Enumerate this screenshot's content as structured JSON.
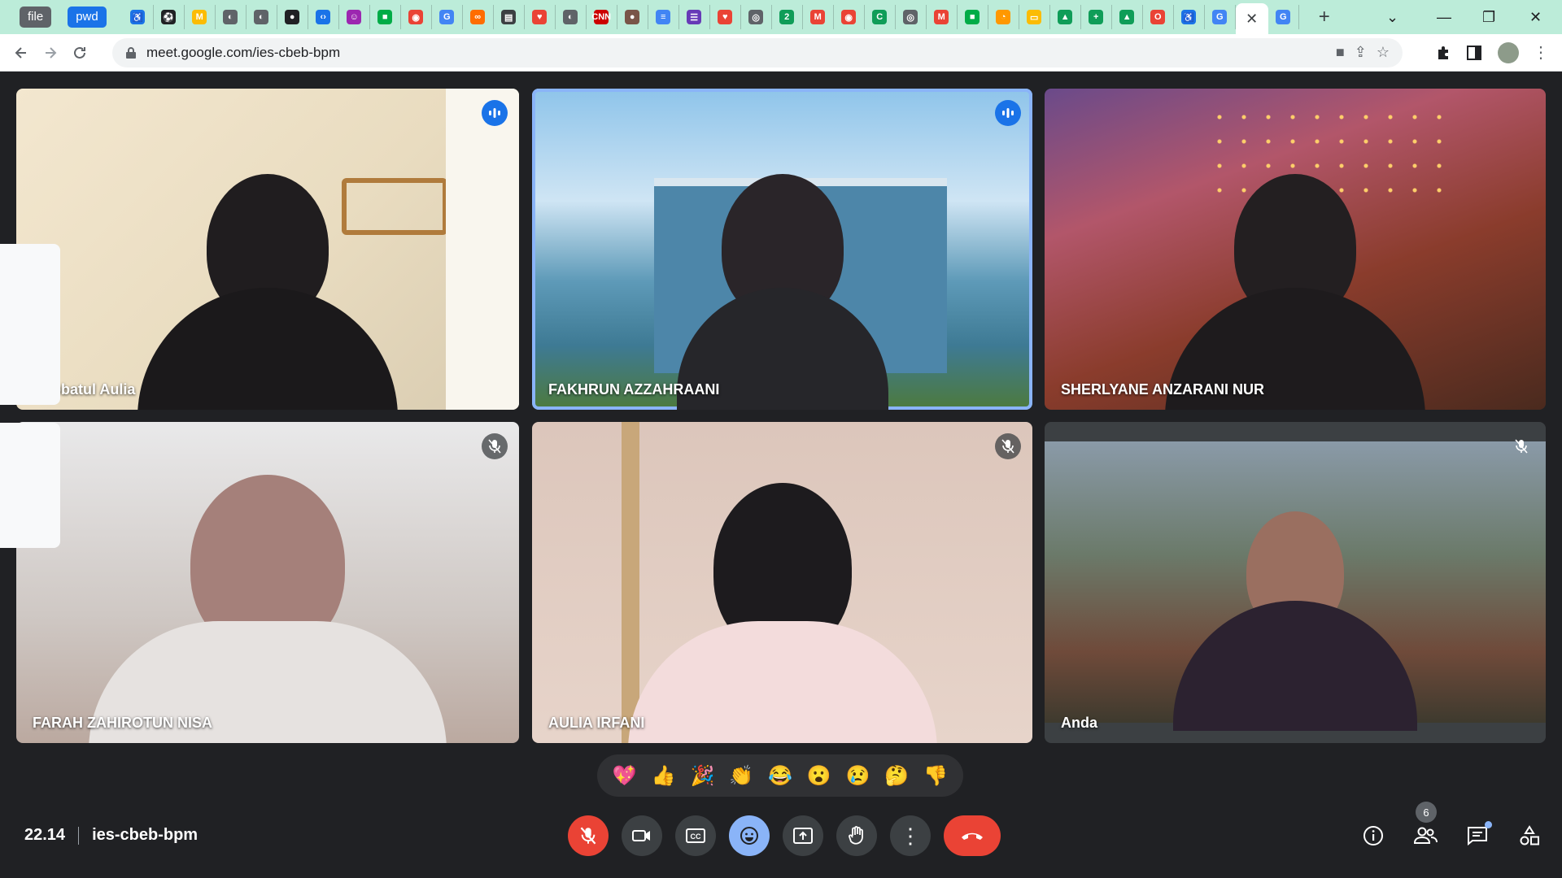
{
  "browser": {
    "pill_file": "file",
    "pill_pwd": "pwd",
    "favicons": [
      {
        "icon": "accessibility-icon",
        "color": "#1a73e8",
        "glyph": "♿"
      },
      {
        "icon": "soccer-icon",
        "color": "#202124",
        "glyph": "⚽"
      },
      {
        "icon": "tagline-icon",
        "color": "#fbbc04",
        "glyph": "M"
      },
      {
        "icon": "globe-icon",
        "color": "#5f6368",
        "glyph": "◐"
      },
      {
        "icon": "globe-icon",
        "color": "#5f6368",
        "glyph": "◐"
      },
      {
        "icon": "github-icon",
        "color": "#202124",
        "glyph": "●"
      },
      {
        "icon": "code-icon",
        "color": "#1a73e8",
        "glyph": "‹›"
      },
      {
        "icon": "bot-icon",
        "color": "#9c27b0",
        "glyph": "☺"
      },
      {
        "icon": "meet-icon",
        "color": "#00ac47",
        "glyph": "■"
      },
      {
        "icon": "record-icon",
        "color": "#ea4335",
        "glyph": "◉"
      },
      {
        "icon": "google-icon",
        "color": "#4285f4",
        "glyph": "G"
      },
      {
        "icon": "link-icon",
        "color": "#ff6d00",
        "glyph": "∞"
      },
      {
        "icon": "notes-icon",
        "color": "#3c4043",
        "glyph": "▤"
      },
      {
        "icon": "heart-icon",
        "color": "#ea4335",
        "glyph": "♥"
      },
      {
        "icon": "globe-icon",
        "color": "#5f6368",
        "glyph": "◐"
      },
      {
        "icon": "cnn-icon",
        "color": "#cc0000",
        "glyph": "CNN"
      },
      {
        "icon": "avatar-icon",
        "color": "#795548",
        "glyph": "●"
      },
      {
        "icon": "docs-icon",
        "color": "#4285f4",
        "glyph": "≡"
      },
      {
        "icon": "forms-icon",
        "color": "#673ab7",
        "glyph": "☰"
      },
      {
        "icon": "heart-icon",
        "color": "#ea4335",
        "glyph": "♥"
      },
      {
        "icon": "chrome-icon",
        "color": "#5f6368",
        "glyph": "◎"
      },
      {
        "icon": "number-icon",
        "color": "#0f9d58",
        "glyph": "2"
      },
      {
        "icon": "gmail-icon",
        "color": "#ea4335",
        "glyph": "M"
      },
      {
        "icon": "record-icon",
        "color": "#ea4335",
        "glyph": "◉"
      },
      {
        "icon": "classroom-icon",
        "color": "#0f9d58",
        "glyph": "C"
      },
      {
        "icon": "chrome-icon",
        "color": "#5f6368",
        "glyph": "◎"
      },
      {
        "icon": "gmail-icon",
        "color": "#ea4335",
        "glyph": "M"
      },
      {
        "icon": "meet-icon",
        "color": "#00ac47",
        "glyph": "■"
      },
      {
        "icon": "hangouts-icon",
        "color": "#ff9800",
        "glyph": "◔"
      },
      {
        "icon": "slides-icon",
        "color": "#fbbc04",
        "glyph": "▭"
      },
      {
        "icon": "drive-icon",
        "color": "#0f9d58",
        "glyph": "▲"
      },
      {
        "icon": "plus-app-icon",
        "color": "#0f9d58",
        "glyph": "+"
      },
      {
        "icon": "drive-icon",
        "color": "#0f9d58",
        "glyph": "▲"
      },
      {
        "icon": "opera-icon",
        "color": "#ea4335",
        "glyph": "O"
      },
      {
        "icon": "accessibility-icon",
        "color": "#1a73e8",
        "glyph": "♿"
      },
      {
        "icon": "google-icon",
        "color": "#4285f4",
        "glyph": "G"
      }
    ],
    "active_tab_close": "✕",
    "next_tab_icon": "G",
    "new_tab": "+",
    "url": "meet.google.com/ies-cbeb-bpm",
    "window": {
      "dropdown": "⌄",
      "minimize": "—",
      "restore": "❐",
      "close": "✕"
    }
  },
  "participants": [
    {
      "name": "Robbatul Aulia",
      "status": "speaking"
    },
    {
      "name": "FAKHRUN AZZAHRAANI",
      "status": "speaking",
      "active": true
    },
    {
      "name": "SHERLYANE ANZARANI NUR",
      "status": "none"
    },
    {
      "name": "FARAH ZAHIROTUN NISA",
      "status": "muted"
    },
    {
      "name": "AULIA IRFANI",
      "status": "muted"
    },
    {
      "name": "Anda",
      "status": "muted"
    }
  ],
  "reactions": [
    "💖",
    "👍",
    "🎉",
    "👏",
    "😂",
    "😮",
    "😢",
    "🤔",
    "👎"
  ],
  "meeting": {
    "time": "22.14",
    "code": "ies-cbeb-bpm",
    "people_count": "6"
  },
  "colors": {
    "speaking_badge": "#1a73e8",
    "active_outline": "#8ab4f8",
    "end_call": "#ea4335",
    "stage_bg": "#202124"
  }
}
